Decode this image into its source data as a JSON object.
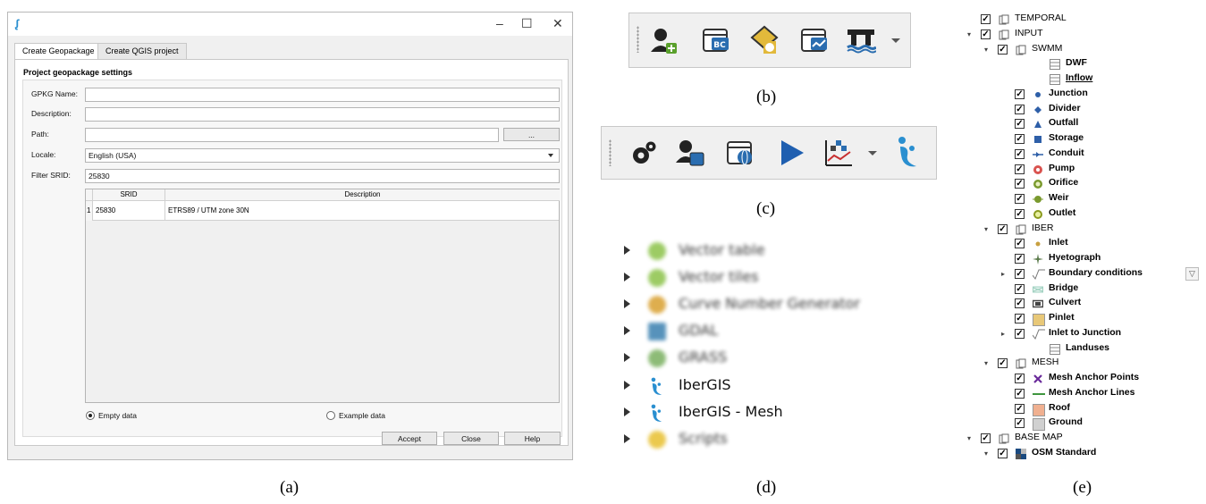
{
  "dialog": {
    "app_icon": "iber-icon",
    "window_controls": [
      "–",
      "☐",
      "✕"
    ],
    "tabs": [
      "Create Geopackage",
      "Create QGIS project"
    ],
    "section_title": "Project geopackage settings",
    "fields": {
      "gpkg_name_label": "GPKG Name:",
      "gpkg_name_value": "",
      "description_label": "Description:",
      "description_value": "",
      "path_label": "Path:",
      "path_value": "",
      "browse_label": "...",
      "locale_label": "Locale:",
      "locale_value": "English (USA)",
      "filter_srid_label": "Filter SRID:",
      "filter_srid_value": "25830"
    },
    "table": {
      "columns": [
        "SRID",
        "Description"
      ],
      "rows": [
        {
          "index": "1",
          "srid": "25830",
          "description": "ETRS89 / UTM zone 30N"
        }
      ]
    },
    "radios": [
      {
        "label": "Empty data",
        "selected": true
      },
      {
        "label": "Example data",
        "selected": false
      }
    ],
    "buttons": [
      "Accept",
      "Close",
      "Help"
    ]
  },
  "captions": {
    "a": "(a)",
    "b": "(b)",
    "c": "(c)",
    "d": "(d)",
    "e": "(e)"
  },
  "toolbar_b": {
    "tools": [
      "add-user-icon",
      "table-bc-icon",
      "layer-star-icon",
      "table-chart-icon",
      "bridge-icon"
    ],
    "has_dropdown": true
  },
  "toolbar_c": {
    "tools": [
      "gears-icon",
      "user-table-icon",
      "table-globe-icon",
      "play-icon",
      "results-chart-icon",
      "iber-logo-icon"
    ],
    "has_dropdown": true
  },
  "plugins": [
    {
      "name": "Vector table",
      "blurred": true,
      "icon": "qgis-icon"
    },
    {
      "name": "Vector tiles",
      "blurred": true,
      "icon": "qgis-icon"
    },
    {
      "name": "Curve Number Generator",
      "blurred": true,
      "icon": "globe-icon"
    },
    {
      "name": "GDAL",
      "blurred": true,
      "icon": "gdal-icon"
    },
    {
      "name": "GRASS",
      "blurred": true,
      "icon": "grass-icon"
    },
    {
      "name": "IberGIS",
      "blurred": false,
      "icon": "iber-logo-icon"
    },
    {
      "name": "IberGIS - Mesh",
      "blurred": false,
      "icon": "iber-logo-icon"
    },
    {
      "name": "Scripts",
      "blurred": true,
      "icon": "python-icon"
    }
  ],
  "layer_tree": [
    {
      "label": "TEMPORAL",
      "kind": "group",
      "bold": false
    },
    {
      "label": "INPUT",
      "kind": "group",
      "bold": false
    },
    {
      "label": "SWMM",
      "kind": "group",
      "bold": false
    },
    {
      "label": "DWF",
      "kind": "table",
      "bold": true
    },
    {
      "label": "Inflow",
      "kind": "table",
      "bold": true,
      "underline": true
    },
    {
      "label": "Junction",
      "kind": "dot",
      "bold": true,
      "color": "#2e5fa8"
    },
    {
      "label": "Divider",
      "kind": "diamond",
      "bold": true,
      "color": "#2e5fa8"
    },
    {
      "label": "Outfall",
      "kind": "triangle",
      "bold": true,
      "color": "#2e5fa8"
    },
    {
      "label": "Storage",
      "kind": "square",
      "bold": true,
      "color": "#2e5fa8"
    },
    {
      "label": "Conduit",
      "kind": "conduit",
      "bold": true,
      "color": "#2e5fa8"
    },
    {
      "label": "Pump",
      "kind": "pump",
      "bold": true,
      "color": "#d9534f"
    },
    {
      "label": "Orifice",
      "kind": "ring",
      "bold": true,
      "color": "#7a9a2e"
    },
    {
      "label": "Weir",
      "kind": "weir",
      "bold": true,
      "color": "#7a9a2e"
    },
    {
      "label": "Outlet",
      "kind": "outlet",
      "bold": true,
      "color": "#8a9a1e"
    },
    {
      "label": "IBER",
      "kind": "group",
      "bold": false
    },
    {
      "label": "Inlet",
      "kind": "smalldot",
      "bold": true,
      "color": "#c8a040"
    },
    {
      "label": "Hyetograph",
      "kind": "star",
      "bold": true,
      "color": "#5a7a4a"
    },
    {
      "label": "Boundary conditions",
      "kind": "sqrt",
      "bold": true
    },
    {
      "label": "Bridge",
      "kind": "bridge",
      "bold": true,
      "color": "#9fd0c0"
    },
    {
      "label": "Culvert",
      "kind": "culvert",
      "bold": true,
      "color": "#444444"
    },
    {
      "label": "Pinlet",
      "kind": "fill",
      "bold": true,
      "color": "#e8c878"
    },
    {
      "label": "Inlet to Junction",
      "kind": "sqrt",
      "bold": true
    },
    {
      "label": "Landuses",
      "kind": "table",
      "bold": true
    },
    {
      "label": "MESH",
      "kind": "group",
      "bold": false
    },
    {
      "label": "Mesh Anchor Points",
      "kind": "cross",
      "bold": true,
      "color": "#6a2a9a"
    },
    {
      "label": "Mesh Anchor Lines",
      "kind": "line",
      "bold": true,
      "color": "#2a8a2a"
    },
    {
      "label": "Roof",
      "kind": "fill",
      "bold": true,
      "color": "#f0b090"
    },
    {
      "label": "Ground",
      "kind": "fill",
      "bold": true,
      "color": "#d0d0d0"
    },
    {
      "label": "BASE MAP",
      "kind": "group",
      "bold": false
    },
    {
      "label": "OSM Standard",
      "kind": "raster",
      "bold": true
    }
  ]
}
